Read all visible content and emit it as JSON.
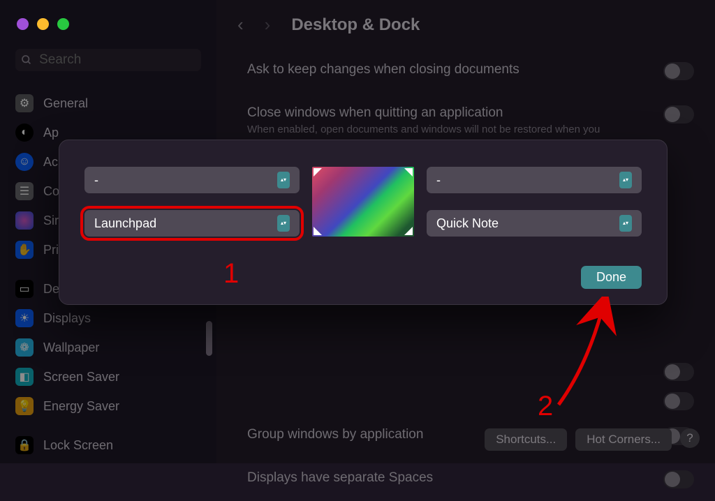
{
  "window": {
    "title": "Desktop & Dock"
  },
  "search": {
    "placeholder": "Search"
  },
  "sidebar": {
    "items": [
      {
        "label": "General"
      },
      {
        "label": "Ap"
      },
      {
        "label": "Ac"
      },
      {
        "label": "Co"
      },
      {
        "label": "Sir"
      },
      {
        "label": "Pri"
      },
      {
        "label": "De"
      },
      {
        "label": "Displays"
      },
      {
        "label": "Wallpaper"
      },
      {
        "label": "Screen Saver"
      },
      {
        "label": "Energy Saver"
      },
      {
        "label": "Lock Screen"
      }
    ]
  },
  "main": {
    "rows": {
      "ask_keep": "Ask to keep changes when closing documents",
      "close_windows": "Close windows when quitting an application",
      "close_windows_sub": "When enabled, open documents and windows will not be restored when you",
      "group_windows": "Group windows by application",
      "separate_spaces": "Displays have separate Spaces"
    },
    "footer": {
      "shortcuts": "Shortcuts...",
      "hotcorners": "Hot Corners...",
      "help": "?"
    }
  },
  "modal": {
    "corners": {
      "top_left": "-",
      "top_right": "-",
      "bottom_left": "Launchpad",
      "bottom_right": "Quick Note"
    },
    "done": "Done"
  },
  "annotations": {
    "one": "1",
    "two": "2"
  }
}
